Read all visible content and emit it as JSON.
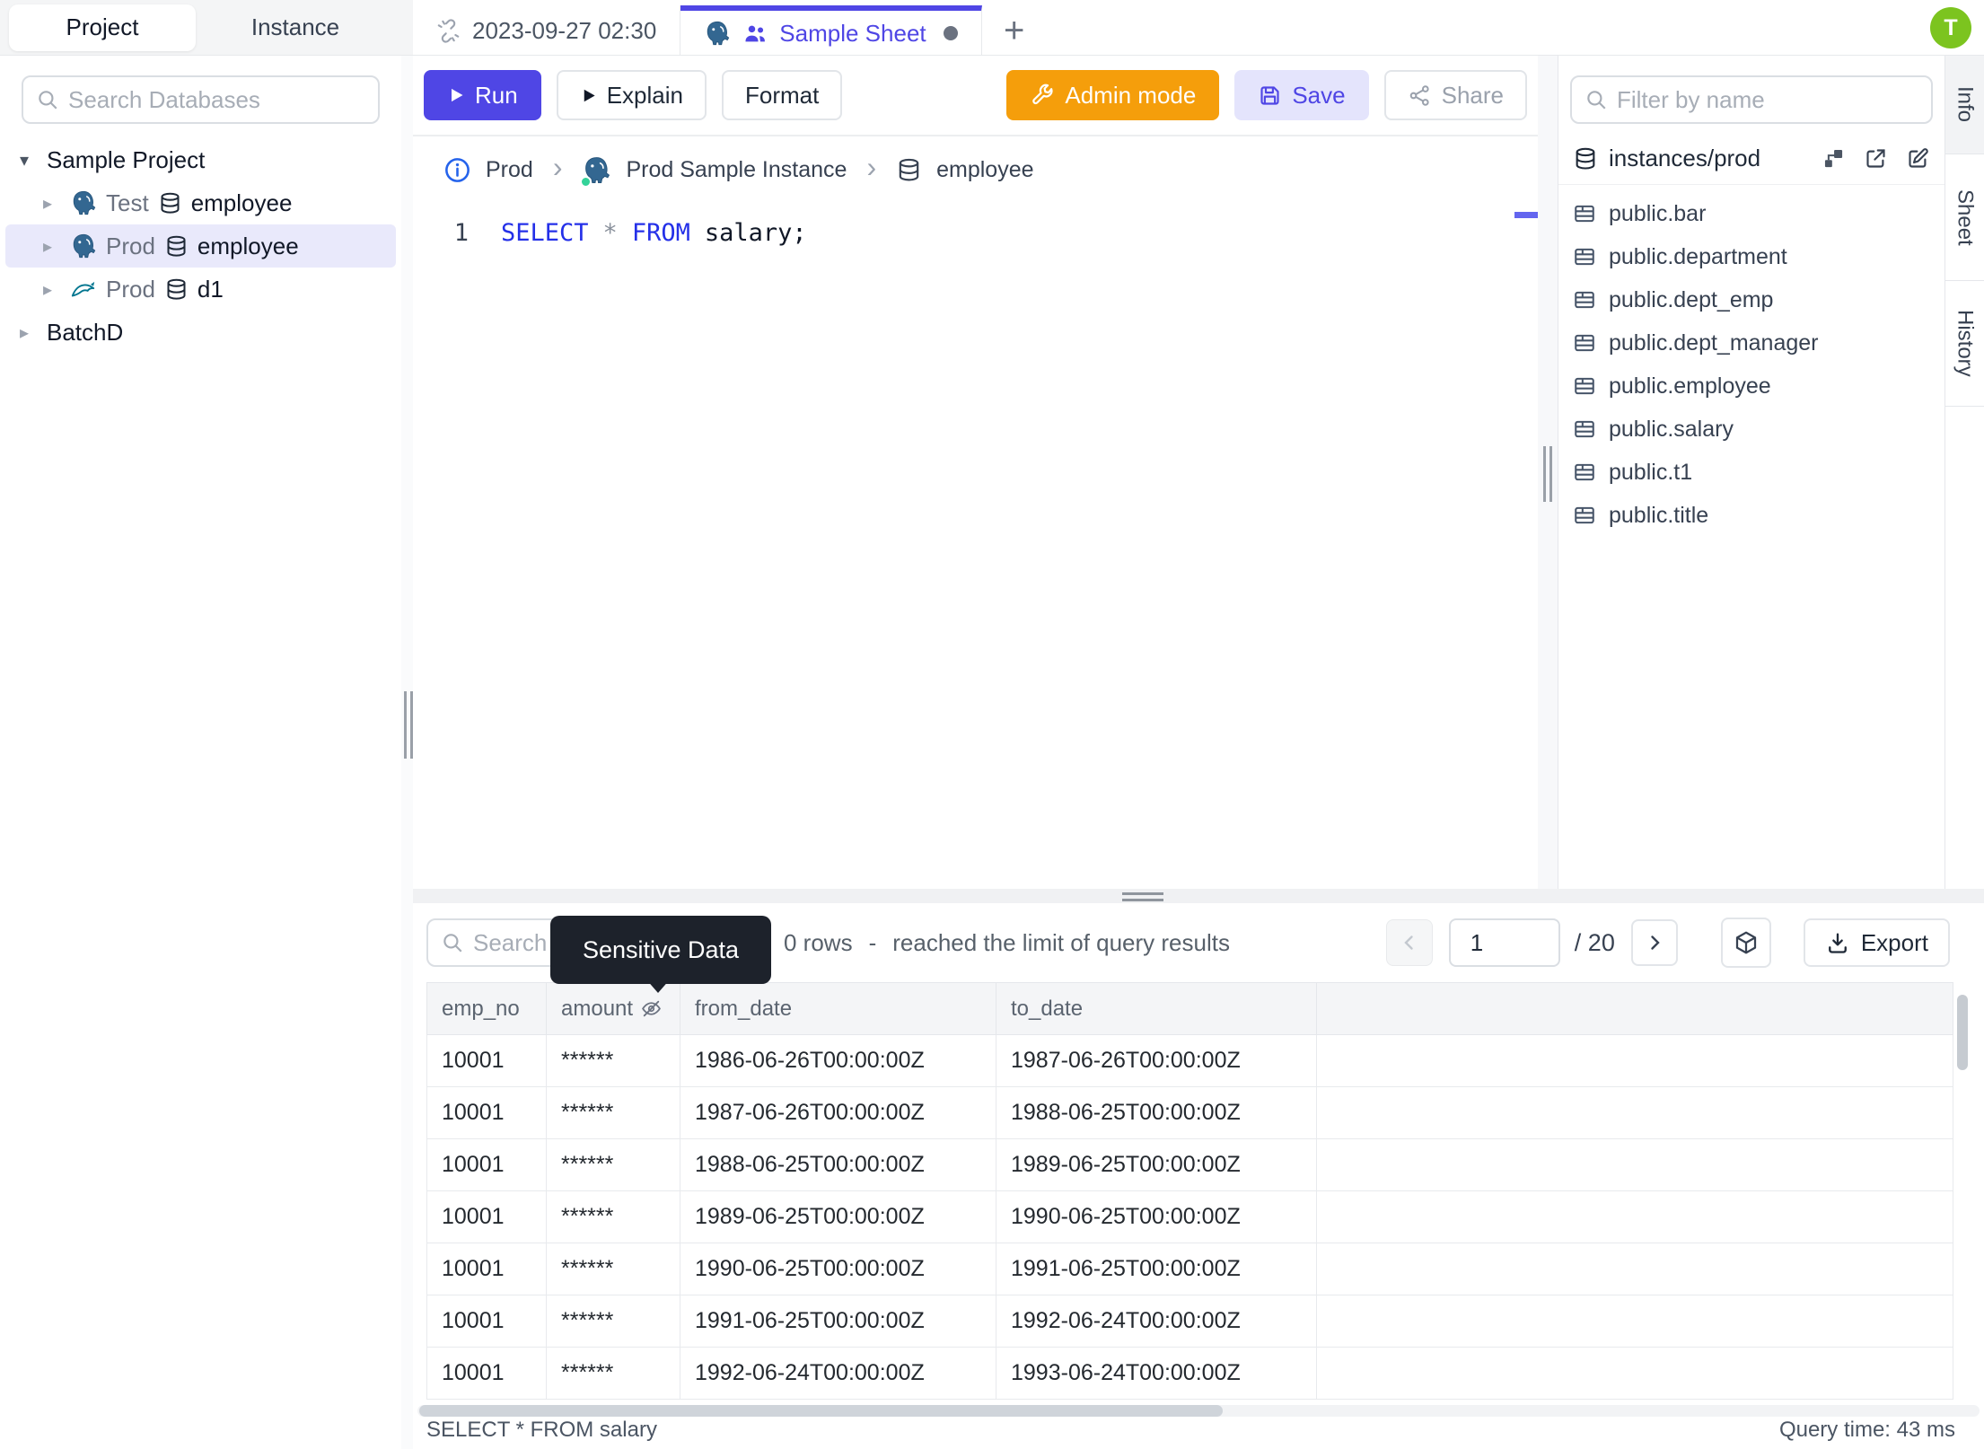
{
  "topbar": {
    "sidebar_tabs": {
      "project": "Project",
      "instance": "Instance"
    },
    "sheet_tabs": [
      {
        "label": "2023-09-27 02:30"
      },
      {
        "label": "Sample Sheet"
      }
    ],
    "new_tab_label": "+",
    "avatar_initial": "T"
  },
  "sidebar": {
    "search_placeholder": "Search Databases",
    "tree": {
      "project1": {
        "label": "Sample Project"
      },
      "node1": {
        "env": "Test",
        "db": "employee"
      },
      "node2": {
        "env": "Prod",
        "db": "employee"
      },
      "node3": {
        "env": "Prod",
        "db": "d1"
      },
      "project2": {
        "label": "BatchD"
      }
    }
  },
  "toolbar": {
    "run": "Run",
    "explain": "Explain",
    "format": "Format",
    "admin_mode": "Admin mode",
    "save": "Save",
    "share": "Share"
  },
  "breadcrumb": {
    "env": "Prod",
    "instance": "Prod Sample Instance",
    "database": "employee"
  },
  "editor": {
    "line_number": "1",
    "tokens": {
      "kw1": "SELECT",
      "star": "*",
      "kw2": "FROM",
      "rest": "salary;"
    }
  },
  "right_panel": {
    "filter_placeholder": "Filter by name",
    "schema_title": "instances/prod",
    "tables": [
      "public.bar",
      "public.department",
      "public.dept_emp",
      "public.dept_manager",
      "public.employee",
      "public.salary",
      "public.t1",
      "public.title"
    ]
  },
  "side_tabs": [
    "Info",
    "Sheet",
    "History"
  ],
  "results": {
    "search_placeholder": "Search",
    "tooltip": "Sensitive Data",
    "rows_text": "0 rows",
    "separator": "-",
    "limit_text": "reached the limit of query results",
    "page_value": "1",
    "page_total": "/ 20",
    "export_label": "Export",
    "columns": [
      "emp_no",
      "amount",
      "from_date",
      "to_date"
    ],
    "rows": [
      {
        "emp_no": "10001",
        "amount": "******",
        "from_date": "1986-06-26T00:00:00Z",
        "to_date": "1987-06-26T00:00:00Z"
      },
      {
        "emp_no": "10001",
        "amount": "******",
        "from_date": "1987-06-26T00:00:00Z",
        "to_date": "1988-06-25T00:00:00Z"
      },
      {
        "emp_no": "10001",
        "amount": "******",
        "from_date": "1988-06-25T00:00:00Z",
        "to_date": "1989-06-25T00:00:00Z"
      },
      {
        "emp_no": "10001",
        "amount": "******",
        "from_date": "1989-06-25T00:00:00Z",
        "to_date": "1990-06-25T00:00:00Z"
      },
      {
        "emp_no": "10001",
        "amount": "******",
        "from_date": "1990-06-25T00:00:00Z",
        "to_date": "1991-06-25T00:00:00Z"
      },
      {
        "emp_no": "10001",
        "amount": "******",
        "from_date": "1991-06-25T00:00:00Z",
        "to_date": "1992-06-24T00:00:00Z"
      },
      {
        "emp_no": "10001",
        "amount": "******",
        "from_date": "1992-06-24T00:00:00Z",
        "to_date": "1993-06-24T00:00:00Z"
      }
    ],
    "status_left": "SELECT * FROM salary",
    "status_right": "Query time: 43 ms"
  },
  "icons": {
    "search": "magnifier",
    "unlink": "broken-chain",
    "users": "two-people",
    "postgres": "blue-elephant",
    "mysql": "teal-dolphin",
    "database": "cylinder",
    "table": "grid",
    "info": "circled-i",
    "wrench": "wrench",
    "save": "floppy-disk",
    "share": "share-nodes",
    "diagram": "linked-squares",
    "external-link": "box-arrow",
    "edit": "square-pencil",
    "eye-off": "crossed-eye",
    "cube": "isometric-box",
    "download": "arrow-into-tray"
  },
  "colors": {
    "accent": "#4f46e5",
    "admin_orange": "#f59e0b",
    "avatar_green": "#7cc41f",
    "keyword_blue": "#2430e8",
    "selected_row_bg": "#e9e9fb",
    "tooltip_bg": "#1d222b",
    "instance_status_green": "#34d399"
  }
}
